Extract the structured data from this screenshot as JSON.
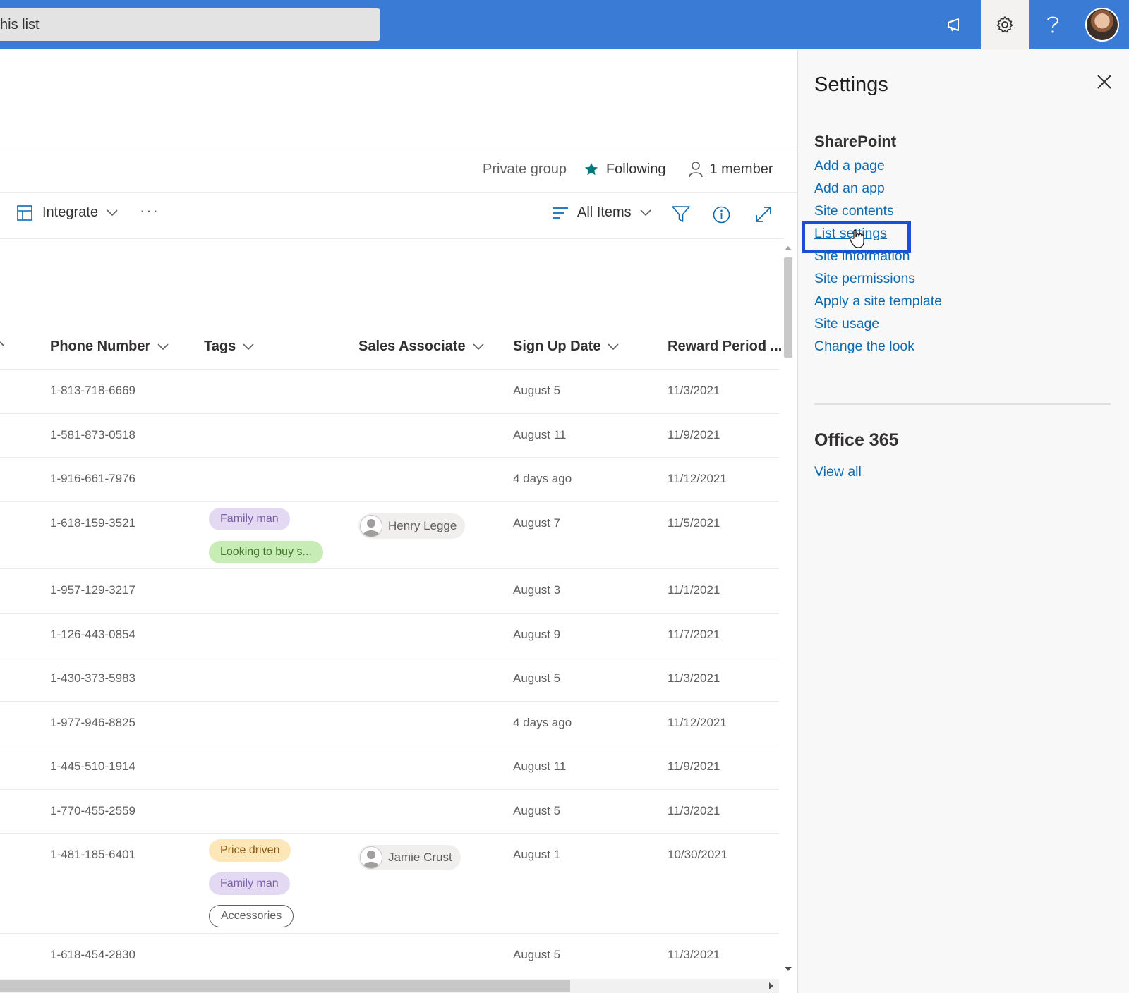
{
  "topbar": {
    "search_text": "his list",
    "icons": [
      "megaphone-icon",
      "gear-icon",
      "help-icon",
      "avatar"
    ]
  },
  "group": {
    "privacy": "Private group",
    "following": "Following",
    "members": "1 member"
  },
  "commands": {
    "integrate": "Integrate",
    "more": "···",
    "view": "All Items"
  },
  "table": {
    "columns": [
      "Phone Number",
      "Tags",
      "Sales Associate",
      "Sign Up Date",
      "Reward Period ..."
    ],
    "rows": [
      {
        "phone": "1-813-718-6669",
        "tags": [],
        "associate": "",
        "signup": "August 5",
        "reward": "11/3/2021"
      },
      {
        "phone": "1-581-873-0518",
        "tags": [],
        "associate": "",
        "signup": "August 11",
        "reward": "11/9/2021"
      },
      {
        "phone": "1-916-661-7976",
        "tags": [],
        "associate": "",
        "signup": "4 days ago",
        "reward": "11/12/2021"
      },
      {
        "phone": "1-618-159-3521",
        "tags": [
          {
            "text": "Family man",
            "color": "purple"
          },
          {
            "text": "Looking to buy s...",
            "color": "green"
          }
        ],
        "associate": "Henry Legge",
        "signup": "August 7",
        "reward": "11/5/2021"
      },
      {
        "phone": "1-957-129-3217",
        "tags": [],
        "associate": "",
        "signup": "August 3",
        "reward": "11/1/2021"
      },
      {
        "phone": "1-126-443-0854",
        "tags": [],
        "associate": "",
        "signup": "August 9",
        "reward": "11/7/2021"
      },
      {
        "phone": "1-430-373-5983",
        "tags": [],
        "associate": "",
        "signup": "August 5",
        "reward": "11/3/2021"
      },
      {
        "phone": "1-977-946-8825",
        "tags": [],
        "associate": "",
        "signup": "4 days ago",
        "reward": "11/12/2021"
      },
      {
        "phone": "1-445-510-1914",
        "tags": [],
        "associate": "",
        "signup": "August 11",
        "reward": "11/9/2021"
      },
      {
        "phone": "1-770-455-2559",
        "tags": [],
        "associate": "",
        "signup": "August 5",
        "reward": "11/3/2021"
      },
      {
        "phone": "1-481-185-6401",
        "tags": [
          {
            "text": "Price driven",
            "color": "orange"
          },
          {
            "text": "Family man",
            "color": "purple"
          },
          {
            "text": "Accessories",
            "color": "outline"
          }
        ],
        "associate": "Jamie Crust",
        "signup": "August 1",
        "reward": "10/30/2021"
      },
      {
        "phone": "1-618-454-2830",
        "tags": [],
        "associate": "",
        "signup": "August 5",
        "reward": "11/3/2021"
      }
    ]
  },
  "settings_panel": {
    "title": "Settings",
    "sharepoint_heading": "SharePoint",
    "sharepoint_links": [
      "Add a page",
      "Add an app",
      "Site contents",
      "List settings",
      "Site information",
      "Site permissions",
      "Apply a site template",
      "Site usage",
      "Change the look"
    ],
    "highlighted_link": "List settings",
    "office_heading": "Office 365",
    "office_links": [
      "View all"
    ]
  },
  "colors": {
    "suite_bar": "#3a7bd5",
    "link": "#0b6ab1",
    "highlight_box": "#1a4fd6",
    "star": "#03787c"
  }
}
